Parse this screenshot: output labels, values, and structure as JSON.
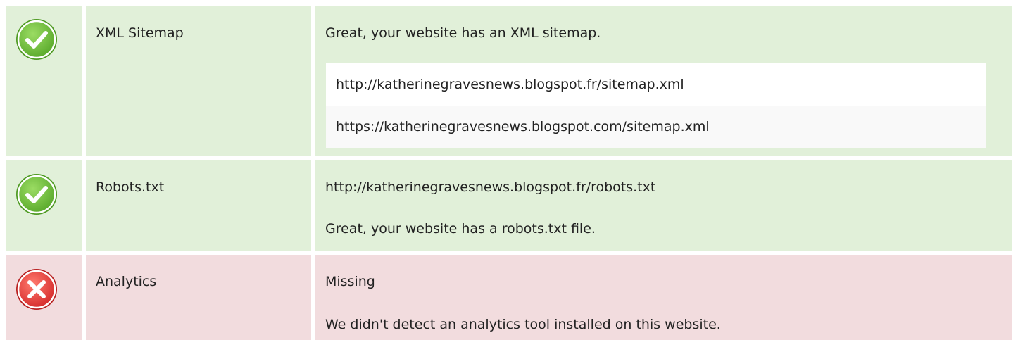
{
  "checks": [
    {
      "status": "pass",
      "status_icon": "check-circle-icon",
      "label": "XML Sitemap",
      "message": "Great, your website has an XML sitemap.",
      "urls": [
        "http://katherinegravesnews.blogspot.fr/sitemap.xml",
        "https://katherinegravesnews.blogspot.com/sitemap.xml"
      ]
    },
    {
      "status": "pass",
      "status_icon": "check-circle-icon",
      "label": "Robots.txt",
      "lines": [
        "http://katherinegravesnews.blogspot.fr/robots.txt",
        "Great, your website has a robots.txt file."
      ]
    },
    {
      "status": "fail",
      "status_icon": "x-circle-icon",
      "label": "Analytics",
      "lines": [
        "Missing",
        "We didn't detect an analytics tool installed on this website."
      ]
    }
  ],
  "colors": {
    "pass_bg": "#e1f0d9",
    "fail_bg": "#f2dcde",
    "pass_icon": "#6cbf3a",
    "fail_icon": "#e03a3a",
    "url_row_a": "#ffffff",
    "url_row_b": "#f9f9f9"
  }
}
